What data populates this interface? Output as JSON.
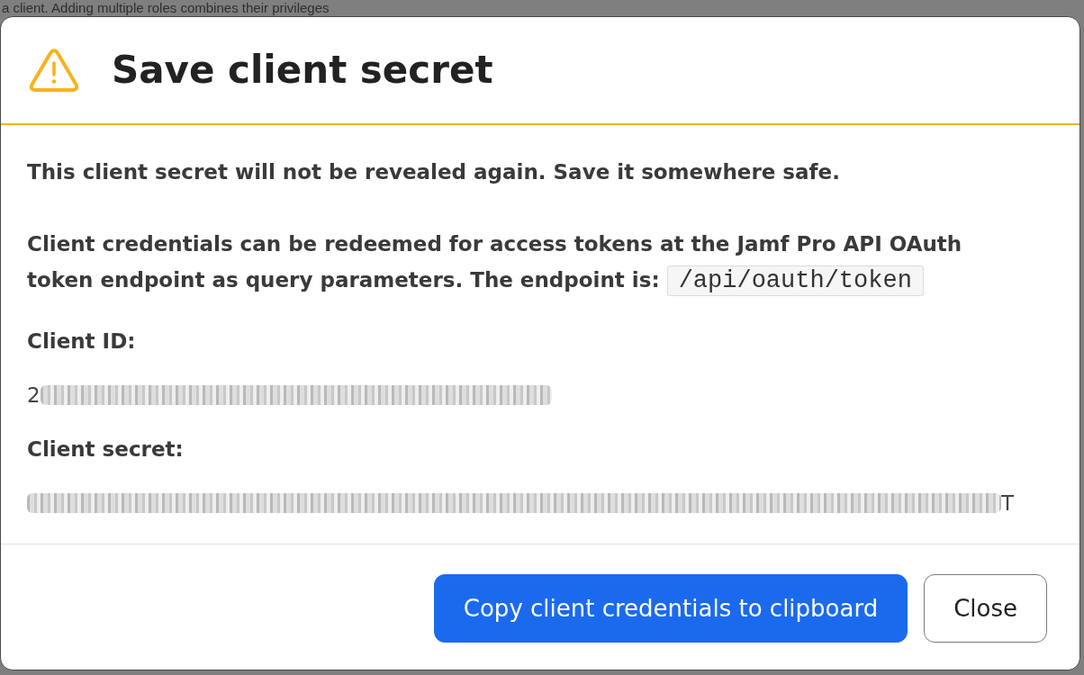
{
  "backdrop": {
    "text": "a client. Adding multiple roles combines their privileges"
  },
  "dialog": {
    "title": "Save client secret",
    "paragraphs": [
      {
        "text": "This client secret will not be revealed again. Save it somewhere safe."
      },
      {
        "text": "Client credentials can be redeemed for access tokens at the Jamf Pro API OAuth token endpoint as query parameters. The endpoint is:",
        "code": "/api/oauth/token"
      }
    ],
    "fields": [
      {
        "label": "Client ID:",
        "parts": [
          {
            "kind": "text",
            "text": "2"
          },
          {
            "kind": "redacted"
          }
        ]
      },
      {
        "label": "Client secret:",
        "parts": [
          {
            "kind": "redacted"
          },
          {
            "kind": "text",
            "text": "T"
          }
        ]
      }
    ],
    "buttons": [
      {
        "label": "Copy client credentials to clipboard",
        "kind": "primary"
      },
      {
        "label": "Close",
        "kind": "secondary"
      }
    ]
  }
}
